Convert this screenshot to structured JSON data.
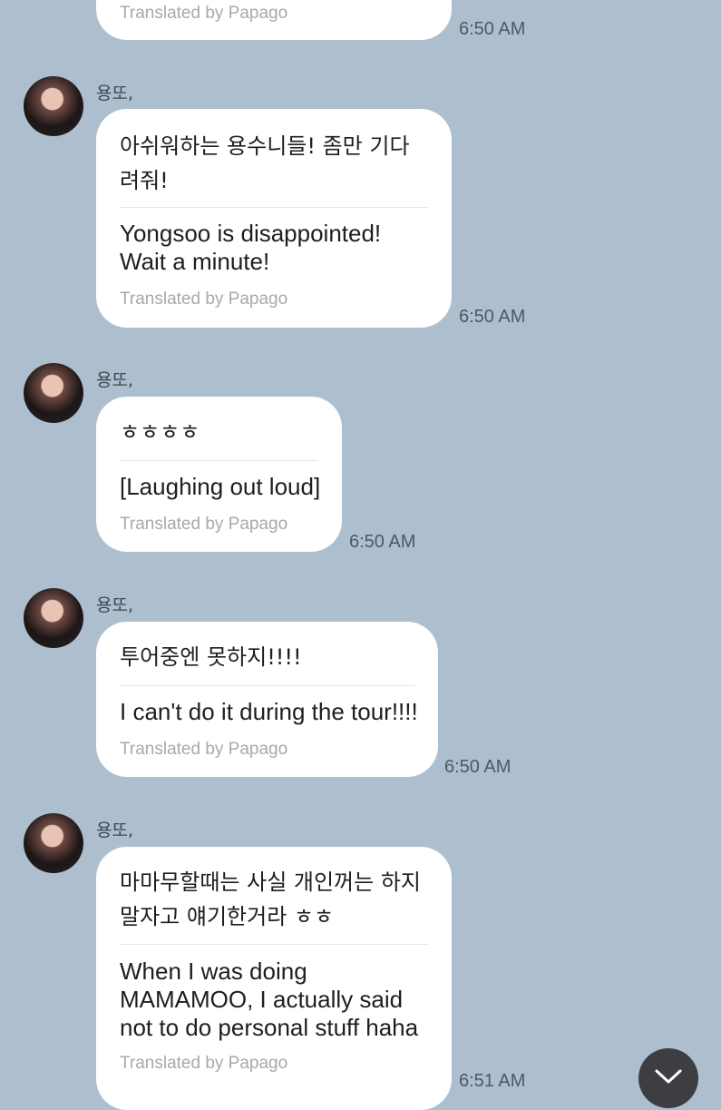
{
  "credit_text": "Translated by Papago",
  "messages": [
    {
      "credit": "Translated by Papago",
      "time": "6:50 AM"
    },
    {
      "sender": "용또,",
      "original": "아쉬워하는 용수니들! 좀만 기다려줘!",
      "translation": "Yongsoo is disappointed! Wait a minute!",
      "credit": "Translated by Papago",
      "time": "6:50 AM"
    },
    {
      "sender": "용또,",
      "original": "ㅎㅎㅎㅎ",
      "translation": "[Laughing out loud]",
      "credit": "Translated by Papago",
      "time": "6:50 AM"
    },
    {
      "sender": "용또,",
      "original": "투어중엔 못하지!!!!",
      "translation": "I can't do it during the tour!!!!",
      "credit": "Translated by Papago",
      "time": "6:50 AM"
    },
    {
      "sender": "용또,",
      "original": "마마무할때는 사실 개인꺼는 하지말자고 얘기한거라 ㅎㅎ",
      "translation": "When I was doing MAMAMOO, I actually said not to do personal stuff haha",
      "credit": "Translated by Papago",
      "time": "6:51 AM"
    }
  ],
  "scroll_button": {
    "icon": "chevron-down-icon"
  }
}
